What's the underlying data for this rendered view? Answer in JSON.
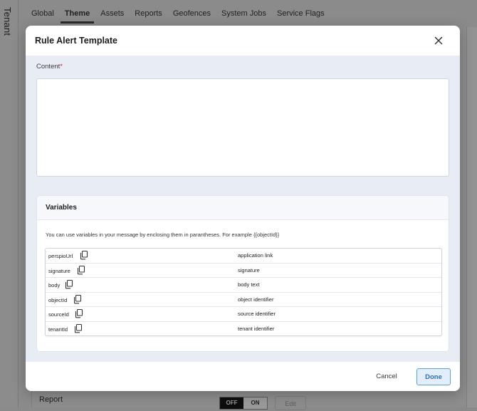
{
  "sidebar": {
    "label": "Tenant"
  },
  "tabs": [
    {
      "label": "Global"
    },
    {
      "label": "Theme",
      "active": true
    },
    {
      "label": "Assets"
    },
    {
      "label": "Reports"
    },
    {
      "label": "Geofences"
    },
    {
      "label": "System Jobs"
    },
    {
      "label": "Service Flags"
    }
  ],
  "background_row": {
    "label": "Report",
    "toggle_off": "OFF",
    "toggle_on": "ON",
    "edit_label": "Edit"
  },
  "modal": {
    "title": "Rule Alert Template",
    "content_label": "Content",
    "required_marker": "*",
    "content_value": "",
    "variables": {
      "title": "Variables",
      "hint": "You can use variables in your message by enclosing them in parantheses. For example {{objectId}}",
      "rows": [
        {
          "name": "perspioUrl",
          "description": "application link"
        },
        {
          "name": "signature",
          "description": "signature"
        },
        {
          "name": "body",
          "description": "body text"
        },
        {
          "name": "objectId",
          "description": "object identifier"
        },
        {
          "name": "sourceId",
          "description": "source identifier"
        },
        {
          "name": "tenantId",
          "description": "tenant identifier"
        }
      ]
    },
    "cancel_label": "Cancel",
    "done_label": "Done"
  },
  "icons": {
    "close": "close-icon",
    "copy": "copy-icon"
  },
  "colors": {
    "accent": "#2c6fb3",
    "required": "#d32f2f",
    "body_bg": "#e8edf5"
  }
}
